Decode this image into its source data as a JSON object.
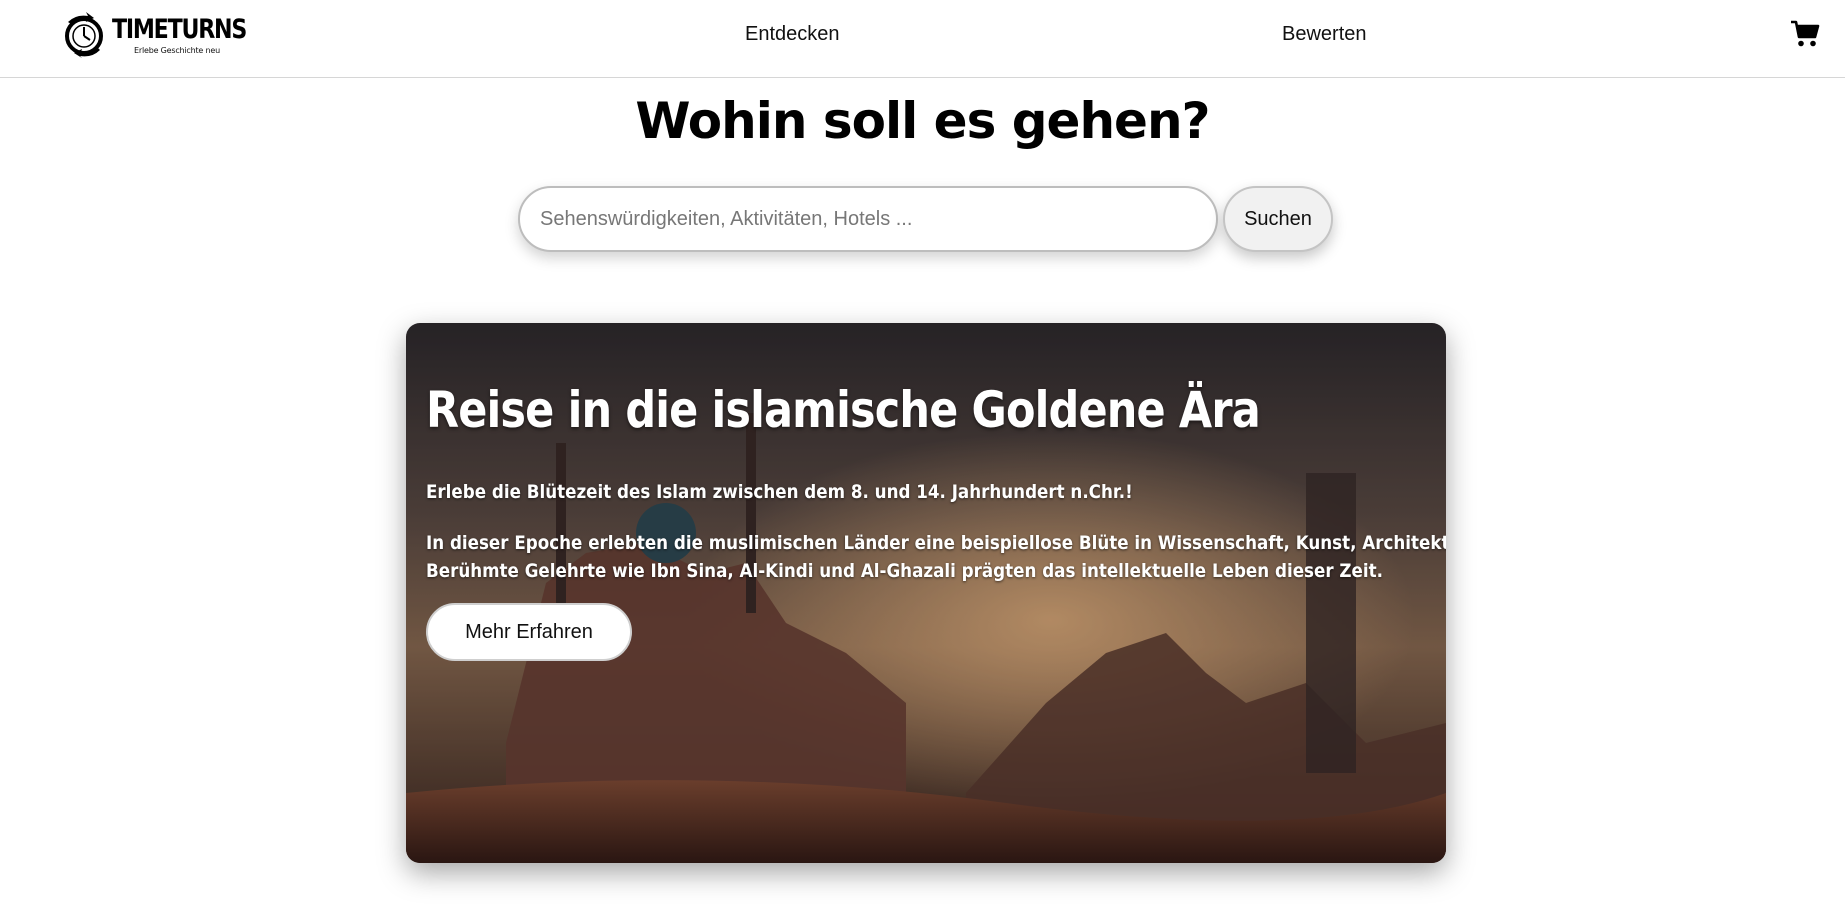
{
  "header": {
    "logo_name": "TIMETURNS",
    "logo_tagline": "Erlebe Geschichte neu",
    "nav": [
      {
        "label": "Entdecken"
      },
      {
        "label": "Bewerten"
      }
    ],
    "cart_icon": "shopping-cart-icon"
  },
  "hero": {
    "title": "Wohin soll es gehen?",
    "search_placeholder": "Sehenswürdigkeiten, Aktivitäten, Hotels ...",
    "search_value": "",
    "search_button": "Suchen"
  },
  "card": {
    "title": "Reise in die islamische Goldene Ära",
    "subtitle": "Erlebe die Blütezeit des Islam zwischen dem 8. und 14. Jahrhundert n.Chr.!",
    "description_line1": "In dieser Epoche erlebten die muslimischen Länder eine beispiellose Blüte in Wissenschaft, Kunst, Architektur und Philosophie.",
    "description_line2": "Berühmte Gelehrte wie Ibn Sina, Al-Kindi und Al-Ghazali prägten das intellektuelle Leben dieser Zeit.",
    "button": "Mehr Erfahren"
  },
  "colors": {
    "header_border": "#d6d6d6",
    "card_text": "#ffffff",
    "search_button_bg": "#f1f1f1"
  }
}
